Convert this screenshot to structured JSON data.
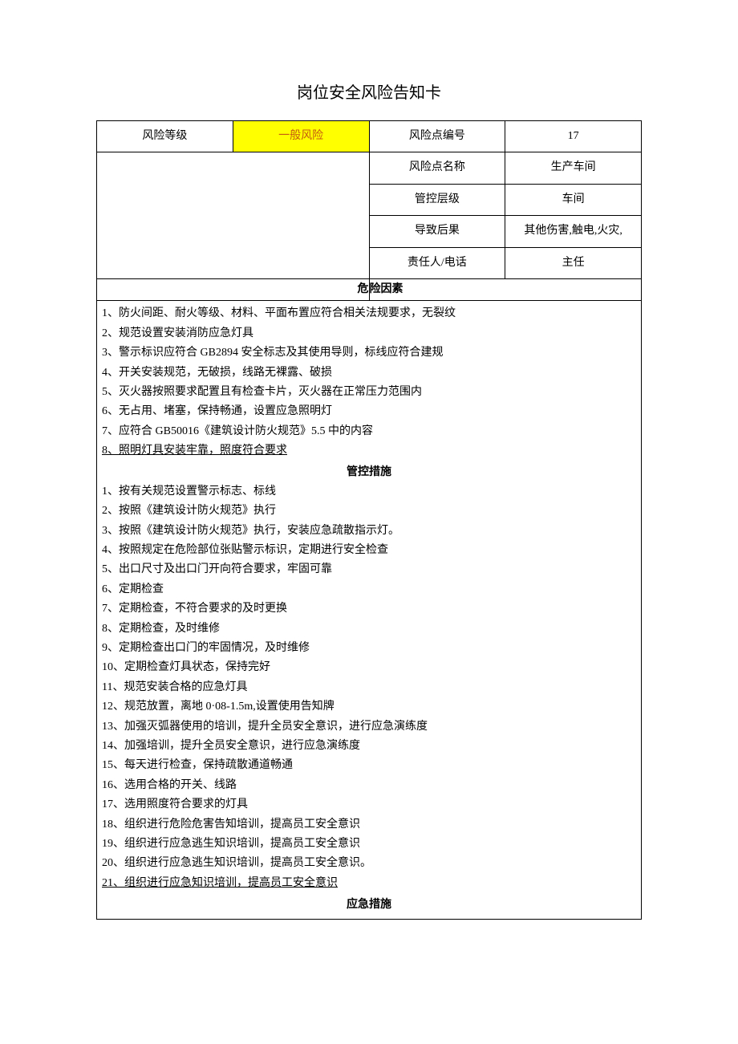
{
  "title": "岗位安全风险告知卡",
  "header": {
    "risk_level_label": "风险等级",
    "risk_level_value": "一般风险",
    "risk_point_no_label": "风险点编号",
    "risk_point_no_value": "17",
    "risk_point_name_label": "风险点名称",
    "risk_point_name_value": "生产车间",
    "control_level_label": "管控层级",
    "control_level_value": "车间",
    "consequence_label": "导致后果",
    "consequence_value": "其他伤害,触电,火灾,",
    "responsible_label": "责任人/电话",
    "responsible_value": "主任"
  },
  "hazard_header_left": "危",
  "hazard_header_right": "险因素",
  "hazard_items": [
    "1、防火间距、耐火等级、材料、平面布置应符合相关法规要求，无裂纹",
    "2、规范设置安装消防应急灯具",
    "3、警示标识应符合 GB2894 安全标志及其使用导则，标线应符合建规",
    "4、开关安装规范，无破损，线路无裸露、破损",
    "5、灭火器按照要求配置且有检查卡片，灭火器在正常压力范围内",
    "6、无占用、堵塞，保持畅通，设置应急照明灯",
    "7、应符合 GB50016《建筑设计防火规范》5.5 中的内容",
    "8、照明灯具安装牢靠，照度符合要求"
  ],
  "control_header": "管控措施",
  "control_items": [
    "1、按有关规范设置警示标志、标线",
    "2、按照《建筑设计防火规范》执行",
    "3、按照《建筑设计防火规范》执行，安装应急疏散指示灯。",
    "4、按照规定在危险部位张贴警示标识，定期进行安全检查",
    "5、出口尺寸及出口门开向符合要求，牢固可靠",
    "6、定期检查",
    "7、定期检查，不符合要求的及时更换",
    "8、定期检查，及时维修",
    "9、定期检查出口门的牢固情况，及时维修",
    "10、定期检查灯具状态，保持完好",
    "11、规范安装合格的应急灯具",
    "12、规范放置，离地 0·08-1.5m,设置使用告知牌",
    "13、加强灭弧器使用的培训，提升全员安全意识，进行应急演练度",
    "14、加强培训，提升全员安全意识，进行应急演练度",
    "15、每天进行检查，保持疏散通道畅通",
    "16、选用合格的开关、线路",
    "17、选用照度符合要求的灯具",
    "18、组织进行危险危害告知培训，提高员工安全意识",
    "19、组织进行应急逃生知识培训，提高员工安全意识",
    "20、组织进行应急逃生知识培训，提高员工安全意识。",
    "21、组织进行应急知识培训，提高员工安全意识"
  ],
  "emergency_header": "应急措施"
}
